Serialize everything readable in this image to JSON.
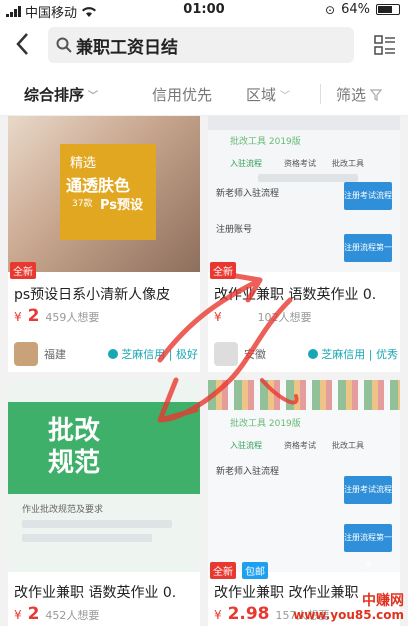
{
  "status_bar": {
    "carrier": "中国移动",
    "time": "01:00",
    "battery": "64%"
  },
  "header": {
    "search_query": "兼职工资日结"
  },
  "sort_bar": {
    "items": [
      "综合排序",
      "信用优先",
      "区域",
      "筛选"
    ]
  },
  "cards": [
    {
      "image": {
        "t1": "精选",
        "t2": "通透肤色",
        "t3": "37款",
        "t4": "Ps预设"
      },
      "tag": "全新",
      "title": "ps预设日系小清新人像皮",
      "price": "2",
      "wants": "459人想要",
      "location": "福建",
      "credit": "芝麻信用 | 极好"
    },
    {
      "image": {
        "heading": "批改工具 2019版",
        "labels": [
          "入驻流程",
          "资格考试",
          "批改工具"
        ],
        "steps": [
          "新老师入驻流程",
          "注册账号"
        ],
        "buttons": [
          "注册考试流程",
          "注册流程第一步"
        ]
      },
      "tag": "全新",
      "title": "改作业兼职 语数英作业 0.",
      "price": "",
      "wants": "102人想要",
      "location": "安徽",
      "credit": "芝麻信用 | 优秀"
    },
    {
      "image": {
        "t1": "批改",
        "t2": "规范",
        "sub": "作业批改规范及要求"
      },
      "tag": "",
      "title": "改作业兼职 语数英作业 0.",
      "price": "2",
      "wants": "452人想要"
    },
    {
      "image": {
        "heading": "批改工具 2019版",
        "labels": [
          "入驻流程",
          "资格考试",
          "批改工具"
        ],
        "steps": [
          "新老师入驻流程"
        ],
        "buttons": [
          "注册考试流程",
          "注册流程第一步"
        ]
      },
      "tags": [
        "全新",
        "包邮"
      ],
      "title": "改作业兼职 改作业兼职",
      "price": "2.98",
      "wants": "157人想要"
    }
  ],
  "watermark": {
    "line1": "中赚网",
    "line2": "www.you85.com"
  },
  "colors": {
    "accent": "#e8382f",
    "credit": "#19a7b5",
    "blue_button": "#2f8fd8",
    "green": "#3fb06a"
  }
}
